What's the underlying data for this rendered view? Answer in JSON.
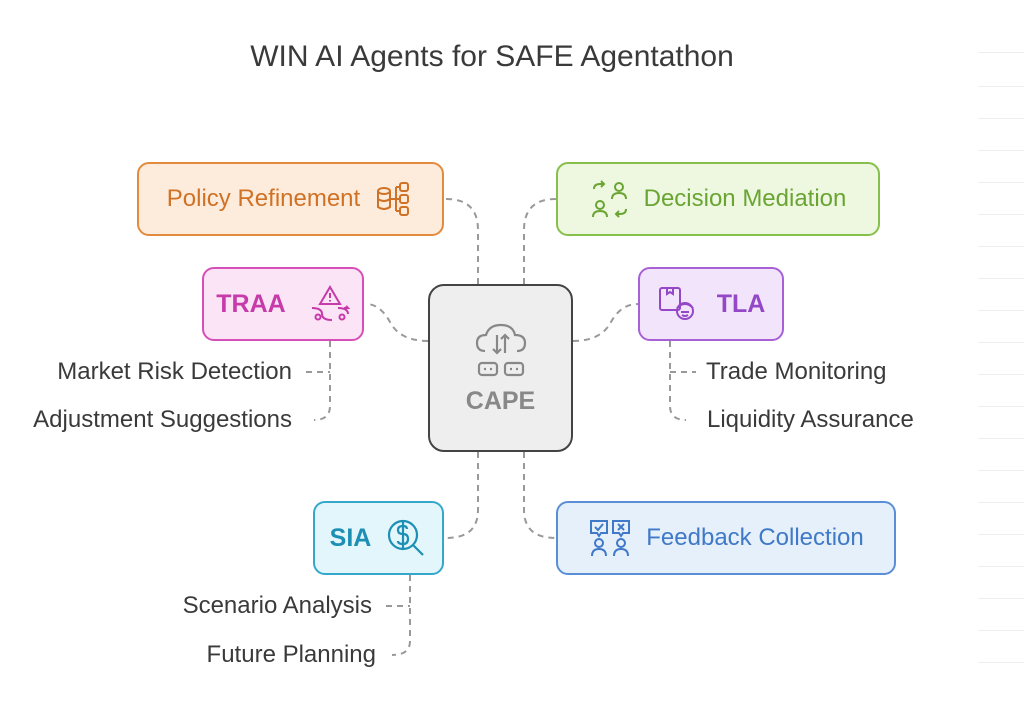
{
  "title": "WIN AI Agents for SAFE Agentathon",
  "center": {
    "label": "CAPE",
    "icon": "cloud-transfer-icon"
  },
  "nodes": {
    "policy": {
      "label": "Policy Refinement",
      "icon": "database-tree-icon",
      "color": "#e28a3e"
    },
    "decision": {
      "label": "Decision Mediation",
      "icon": "people-exchange-icon",
      "color": "#86c04a"
    },
    "traa": {
      "label": "TRAA",
      "icon": "warning-route-icon",
      "color": "#d64fb8"
    },
    "tla": {
      "label": "TLA",
      "icon": "worker-package-icon",
      "color": "#a860d6"
    },
    "sia": {
      "label": "SIA",
      "icon": "dollar-search-icon",
      "color": "#34a8cb"
    },
    "feedback": {
      "label": "Feedback Collection",
      "icon": "voting-people-icon",
      "color": "#5a8fd5"
    }
  },
  "leaves": {
    "traa": [
      "Market Risk Detection",
      "Adjustment Suggestions"
    ],
    "tla": [
      "Trade Monitoring",
      "Liquidity Assurance"
    ],
    "sia": [
      "Scenario Analysis",
      "Future Planning"
    ]
  }
}
